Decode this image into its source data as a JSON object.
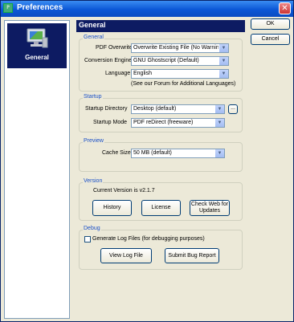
{
  "window": {
    "title": "Preferences",
    "app_icon": "pdf-icon",
    "close_glyph": "✕"
  },
  "nav": {
    "items": [
      {
        "label": "General",
        "icon": "computer-settings-icon"
      }
    ]
  },
  "header": {
    "title": "General"
  },
  "buttons": {
    "ok": "OK",
    "cancel": "Cancel"
  },
  "general": {
    "title": "General",
    "pdf_overwrite": {
      "label": "PDF Overwrite",
      "value": "Overwrite Existing File (No Warning)"
    },
    "conversion_engine": {
      "label": "Conversion Engine",
      "value": "GNU Ghostscript (Default)"
    },
    "language": {
      "label": "Language",
      "value": "English"
    },
    "forum_note": "(See our Forum for Additional Languages)"
  },
  "startup": {
    "title": "Startup",
    "directory": {
      "label": "Startup Directory",
      "value": "Desktop (default)",
      "browse_label": "..."
    },
    "mode": {
      "label": "Startup Mode",
      "value": "PDF reDirect (freeware)"
    }
  },
  "preview": {
    "title": "Preview",
    "cache_size": {
      "label": "Cache Size",
      "value": "50 MB (default)"
    }
  },
  "version": {
    "title": "Version",
    "current": "Current Version is v2.1.7",
    "history": "History",
    "license": "License",
    "check_web_line1": "Check Web for",
    "check_web_line2": "Updates"
  },
  "debug": {
    "title": "Debug",
    "generate_log": "Generate Log Files (for debugging purposes)",
    "generate_log_checked": false,
    "view_log": "View Log File",
    "submit_bug": "Submit Bug Report"
  },
  "colors": {
    "header_bg": "#0d1b62",
    "group_title": "#1a50c8",
    "window_bg": "#ece9d8",
    "titlebar": "#0b57d6"
  }
}
